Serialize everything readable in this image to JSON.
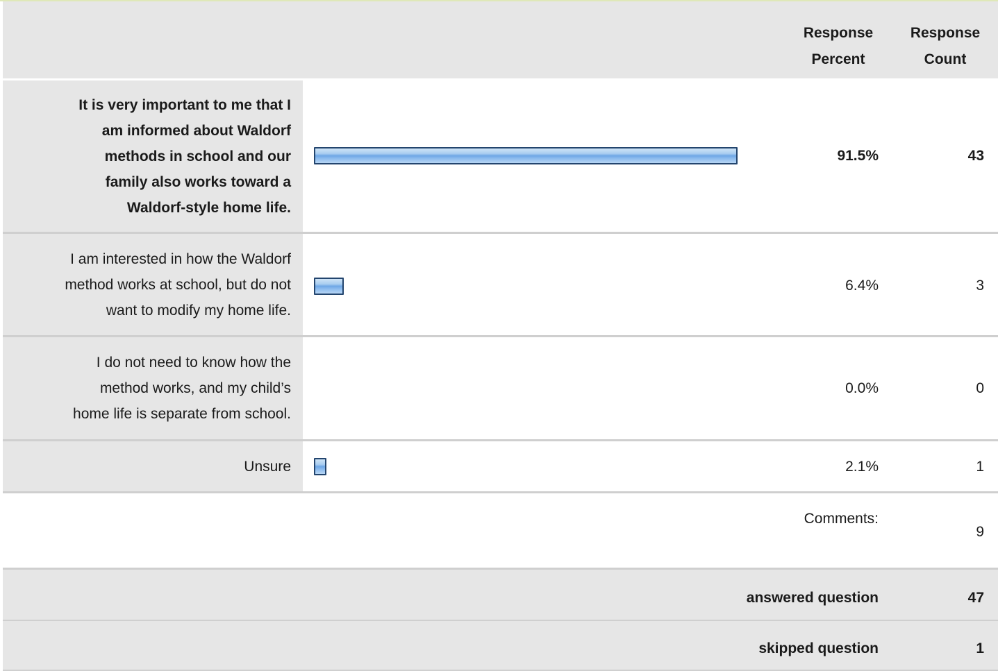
{
  "header": {
    "response_percent": "Response\nPercent",
    "response_count": "Response\nCount"
  },
  "chart_data": {
    "type": "bar",
    "categories": [
      "It is very important to me that I am informed about Waldorf methods in school and our family also works toward a Waldorf-style home life.",
      "I am interested in how the Waldorf method works at school, but do not want to modify my home life.",
      "I do not need to know how the method works, and my child’s home life is separate from school.",
      "Unsure"
    ],
    "values": [
      91.5,
      6.4,
      0.0,
      2.1
    ],
    "percent_labels": [
      "91.5%",
      "6.4%",
      "0.0%",
      "2.1%"
    ],
    "counts": [
      "43",
      "3",
      "0",
      "1"
    ],
    "xlim": [
      0,
      100
    ]
  },
  "rows": [
    {
      "lines": [
        "It is very important to me that I",
        "am informed about Waldorf",
        "methods in school and our",
        "family also works toward a",
        "Waldorf-style home life."
      ]
    },
    {
      "lines": [
        "I am interested in how the Waldorf",
        "method works at school, but do not",
        "want to modify my home life."
      ]
    },
    {
      "lines": [
        "I do not need to know how the",
        "method works, and my child’s",
        "home life is separate from school."
      ]
    },
    {
      "lines": [
        "Unsure"
      ]
    }
  ],
  "comments": {
    "label": "Comments:",
    "count": "9"
  },
  "answered": {
    "label": "answered question",
    "count": "47"
  },
  "skipped": {
    "label": "skipped question",
    "count": "1"
  },
  "colors": {
    "bar_border": "#23456e",
    "bar_fill": "#6ea7e6",
    "row_bg": "#e6e6e6"
  }
}
